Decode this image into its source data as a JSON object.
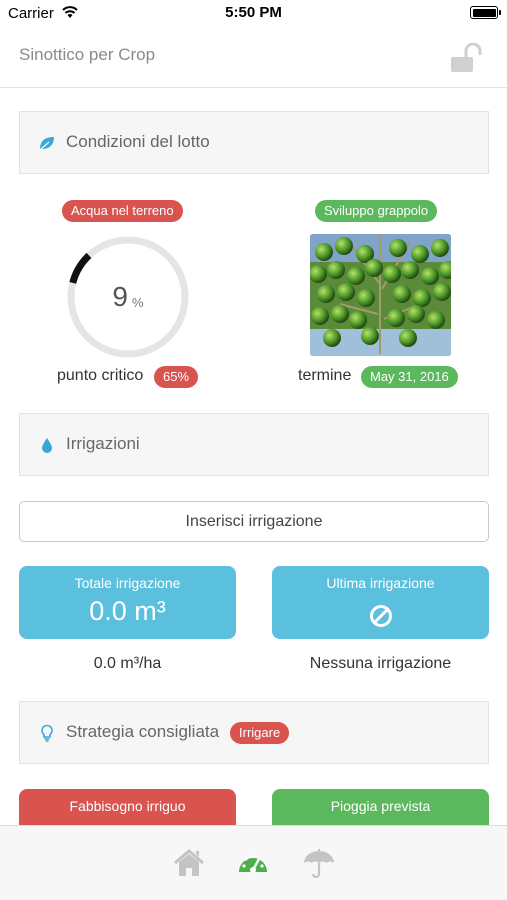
{
  "status_bar": {
    "carrier": "Carrier",
    "time": "5:50 PM"
  },
  "navbar": {
    "title": "Sinottico per Crop",
    "lock_icon": "unlocked-padlock-icon"
  },
  "lot_conditions": {
    "header": "Condizioni del lotto",
    "icon": "leaf-icon",
    "soil_water": {
      "badge": "Acqua nel terreno",
      "value": "9",
      "unit": "%",
      "fill_fraction": 0.09,
      "critical_label": "punto critico",
      "critical_badge": "65%"
    },
    "development": {
      "badge": "Sviluppo grappolo",
      "image": "grape-cluster-photo",
      "end_label": "termine",
      "end_badge": "May 31, 2016"
    }
  },
  "irrigations": {
    "header": "Irrigazioni",
    "icon": "water-drop-icon",
    "insert_button": "Inserisci irrigazione",
    "total_card": {
      "title": "Totale irrigazione",
      "value": "0.0 m³",
      "caption": "0.0 m³/ha"
    },
    "last_card": {
      "title": "Ultima irrigazione",
      "icon": "prohibited-icon",
      "caption": "Nessuna irrigazione"
    }
  },
  "strategy": {
    "header": "Strategia consigliata",
    "icon": "lightbulb-icon",
    "badge": "Irrigare",
    "need_card": "Fabbisogno irriguo",
    "rain_card": "Pioggia prevista"
  },
  "tabbar": {
    "tabs": [
      {
        "icon": "home-icon",
        "active": false
      },
      {
        "icon": "dashboard-gauge-icon",
        "active": true
      },
      {
        "icon": "umbrella-icon",
        "active": false
      }
    ]
  },
  "colors": {
    "red": "#d9534f",
    "green": "#5cb85c",
    "blue": "#5bc0de",
    "accent_icon": "#38a8d8"
  }
}
